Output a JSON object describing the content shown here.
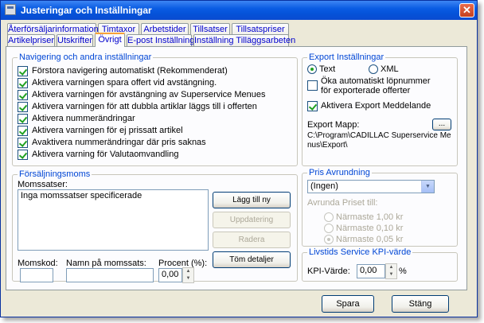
{
  "window": {
    "title": "Justeringar och Inställningar"
  },
  "tabs_row1": [
    "Återförsäljarinformation",
    "Timtaxor",
    "Arbetstider",
    "Tillsatser",
    "Tillsatspriser"
  ],
  "tabs_row2": [
    "Artikelpriser",
    "Utskrifter",
    "Övrigt",
    "E-post Inställningar",
    "Inställning Tilläggsarbeten"
  ],
  "active_tab": "Övrigt",
  "nav": {
    "title": "Navigering och andra inställningar",
    "items": [
      {
        "label": "Förstora navigering automatiskt (Rekommenderat)",
        "checked": true
      },
      {
        "label": "Aktivera varningen spara offert vid avstängning.",
        "checked": true
      },
      {
        "label": "Aktivera varningen för avstängning av Superservice Menues",
        "checked": true
      },
      {
        "label": "Aktivera varningen för att dubbla artiklar läggs till i offerten",
        "checked": true
      },
      {
        "label": "Aktivera nummerändringar",
        "checked": true
      },
      {
        "label": "Aktivera varningen för ej prissatt artikel",
        "checked": true
      },
      {
        "label": "Avaktivera nummerändringar där pris saknas",
        "checked": true
      },
      {
        "label": "Aktivera varning för Valutaomvandling",
        "checked": true
      }
    ]
  },
  "export": {
    "title": "Export Inställningar",
    "radio_text": "Text",
    "radio_xml": "XML",
    "auto_increment_label": "Öka automatiskt löpnummer för exporterade offerter",
    "auto_increment_checked": false,
    "activate_messages_label": "Aktivera Export Meddelande",
    "activate_messages_checked": true,
    "folder_label": "Export Mapp:",
    "folder_path": "C:\\Program\\CADILLAC Superservice Menus\\Export\\",
    "browse_label": "..."
  },
  "vat": {
    "title": "Försäljningsmoms",
    "list_label": "Momssatser:",
    "list_items": [
      "Inga momssatser specificerade"
    ],
    "add_button": "Lägg till ny",
    "update_button": "Uppdatering",
    "delete_button": "Radera",
    "clear_button": "Töm detaljer",
    "code_label": "Momskod:",
    "code_value": "",
    "name_label": "Namn på momssats:",
    "name_value": "",
    "percent_label": "Procent (%):",
    "percent_value": "0,00"
  },
  "rounding": {
    "title": "Pris Avrundning",
    "selected": "(Ingen)",
    "sub_label": "Avrunda Priset till:",
    "options": [
      "Närmaste 1,00 kr",
      "Närmaste 0,10 kr",
      "Närmaste 0,05 kr"
    ],
    "selected_option_index": 2
  },
  "kpi": {
    "title": "Livstids Service KPI-värde",
    "label": "KPI-Värde:",
    "value": "0,00",
    "unit": "%"
  },
  "footer": {
    "save": "Spara",
    "close": "Stäng"
  }
}
